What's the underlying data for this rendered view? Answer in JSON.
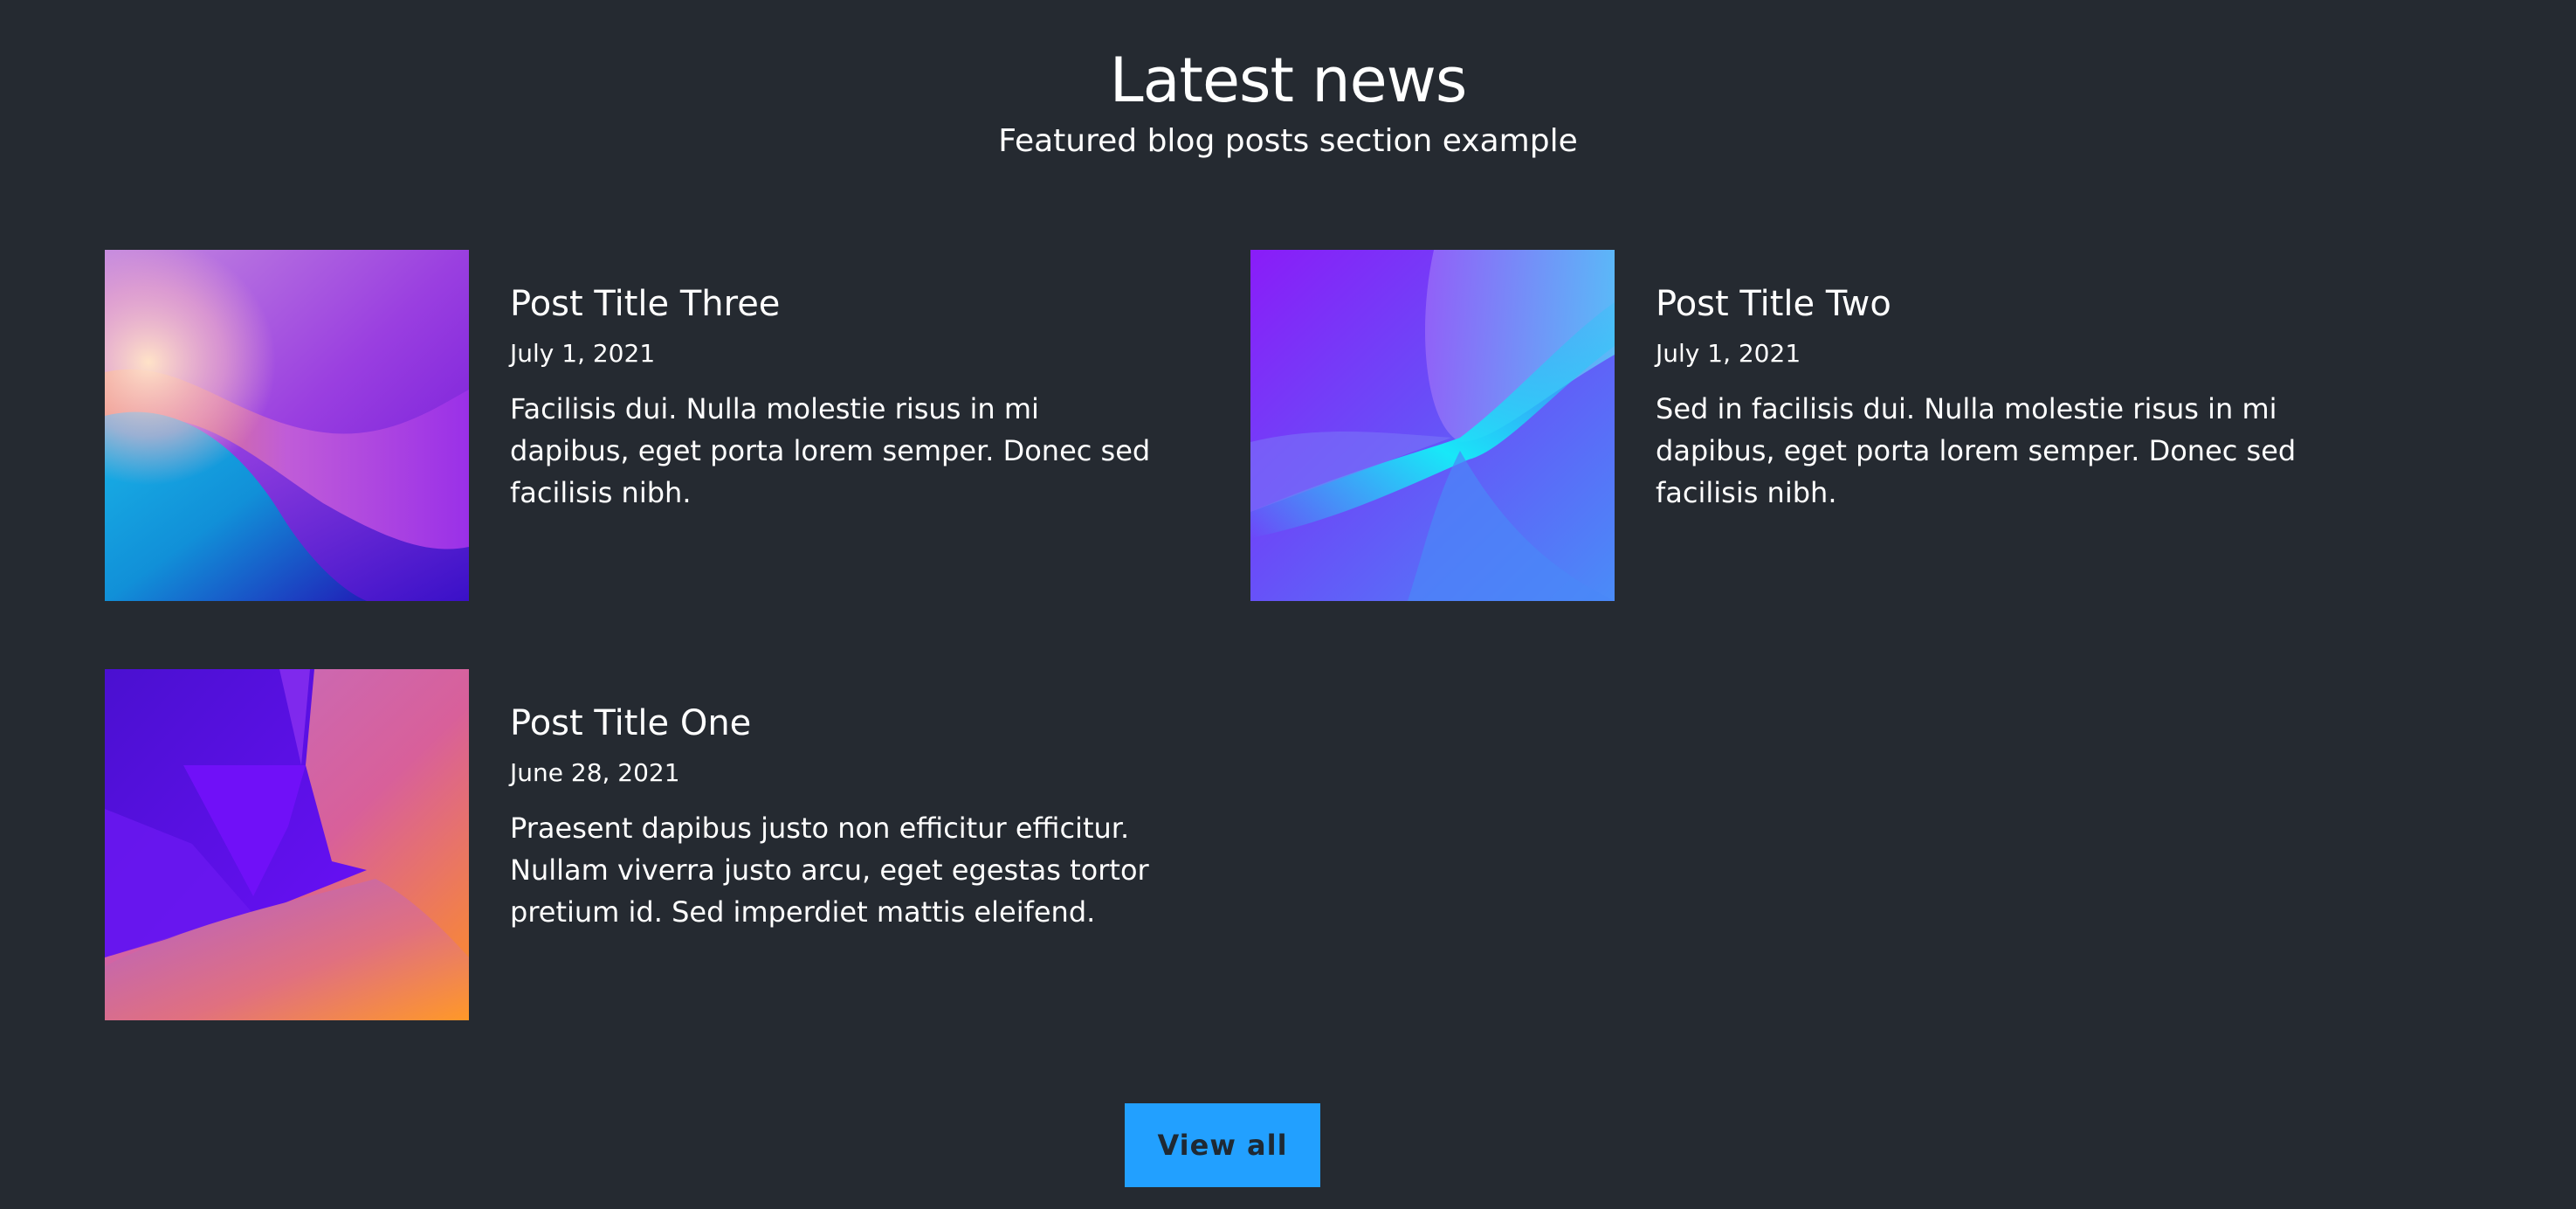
{
  "header": {
    "title": "Latest news",
    "subtitle": "Featured blog posts section example"
  },
  "posts": [
    {
      "title": "Post Title Three",
      "date": "July 1, 2021",
      "excerpt": "Facilisis dui. Nulla molestie risus in mi dapibus, eget porta lorem semper. Donec sed facilisis nibh."
    },
    {
      "title": "Post Title Two",
      "date": "July 1, 2021",
      "excerpt": "Sed in facilisis dui. Nulla molestie risus in mi dapibus, eget porta lorem semper. Donec sed facilisis nibh."
    },
    {
      "title": "Post Title One",
      "date": "June 28, 2021",
      "excerpt": "Praesent dapibus justo non efficitur efficitur. Nullam viverra justo arcu, eget egestas tortor pretium id. Sed imperdiet mattis eleifend."
    }
  ],
  "actions": {
    "view_all_label": "View all"
  },
  "colors": {
    "background": "#252a31",
    "text": "#ffffff",
    "button_bg": "#22a0ff",
    "button_text": "#1f2933"
  }
}
